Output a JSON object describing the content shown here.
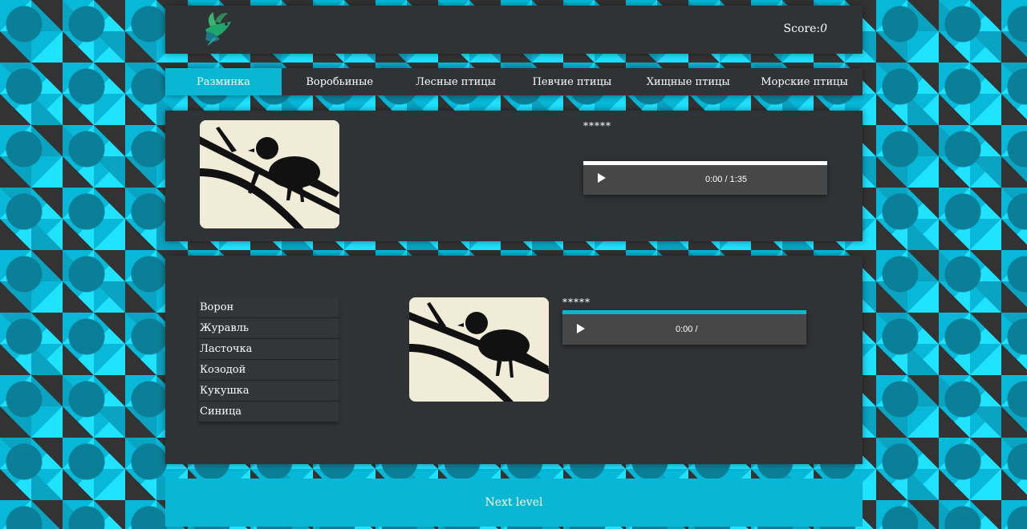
{
  "header": {
    "score_label": "Score:",
    "score_value": "0"
  },
  "nav": {
    "items": [
      {
        "label": "Разминка",
        "active": true
      },
      {
        "label": "Воробьиные"
      },
      {
        "label": "Лесные птицы"
      },
      {
        "label": "Певчие птицы"
      },
      {
        "label": "Хищные птицы"
      },
      {
        "label": "Морские птицы"
      }
    ]
  },
  "question": {
    "bird_name": "*****",
    "player": {
      "time": "0:00 / 1:35"
    }
  },
  "answers": {
    "options": [
      "Ворон",
      "Журавль",
      "Ласточка",
      "Козодой",
      "Кукушка",
      "Синица"
    ],
    "bird_name": "*****",
    "player": {
      "time": "0:00 /"
    }
  },
  "next_button": {
    "label": "Next level"
  },
  "colors": {
    "accent": "#09b6d4",
    "panel": "#303335",
    "player": "#474747"
  }
}
